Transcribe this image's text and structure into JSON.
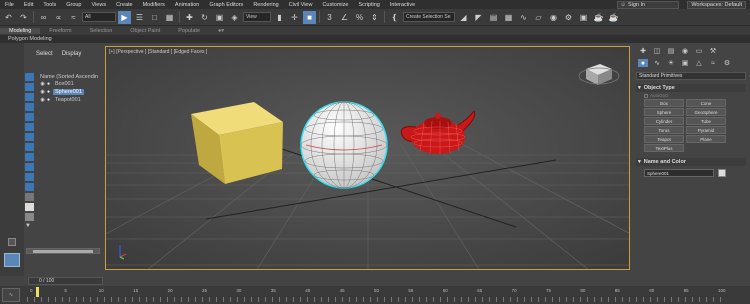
{
  "menu": [
    "File",
    "Edit",
    "Tools",
    "Group",
    "Views",
    "Create",
    "Modifiers",
    "Animation",
    "Graph Editors",
    "Rendering",
    "Civil View",
    "Customize",
    "Scripting",
    "Interactive"
  ],
  "signin": {
    "label": "Sign In"
  },
  "workspace": {
    "label": "Workspaces: Default"
  },
  "toolbar": {
    "filter_value": "All",
    "view_value": "View",
    "snap_3": "3",
    "percent": "%",
    "selection_set_placeholder": "Create Selection Se"
  },
  "ribbon": {
    "tabs": [
      "Modeling",
      "Freeform",
      "Selection",
      "Object Paint",
      "Populate"
    ],
    "active": "Modeling",
    "sub": "Polygon Modeling"
  },
  "scene_explorer": {
    "tabs": [
      "Select",
      "Display"
    ],
    "header": "Name (Sorted Ascendin",
    "items": [
      {
        "name": "Box001",
        "selected": false
      },
      {
        "name": "Sphere001",
        "selected": true
      },
      {
        "name": "Teapot001",
        "selected": false
      }
    ]
  },
  "viewport": {
    "label": "[+] [Perspective ] [Standard ] [Edged Faces ]",
    "border_color": "#c8a040",
    "box_color": "#d8c251",
    "teapot_color": "#c81818",
    "sphere_color": "#f4f4f4",
    "selection_color": "#30e0f0"
  },
  "command_panel": {
    "dropdown": "Standard Primitives",
    "object_type_title": "Object Type",
    "autogrid": "AutoGrid",
    "buttons": [
      "Box",
      "Cone",
      "Sphere",
      "GeoSphere",
      "Cylinder",
      "Tube",
      "Torus",
      "Pyramid",
      "Teapot",
      "Plane",
      "TextPlus"
    ],
    "name_color_title": "Name and Color",
    "object_name": "Sphere001"
  },
  "timeslider": {
    "value": "0 / 100"
  },
  "trackbar": {
    "labels": [
      "0",
      "5",
      "10",
      "15",
      "20",
      "25",
      "30",
      "35",
      "40",
      "45",
      "50",
      "55",
      "60",
      "65",
      "70",
      "75",
      "80",
      "85",
      "90",
      "95",
      "100"
    ]
  },
  "icons": [
    "undo-icon",
    "redo-icon",
    "link-icon",
    "unlink-icon",
    "bind-icon",
    "select-icon",
    "select-by-name-icon",
    "rect-region-icon",
    "window-crossing-icon",
    "move-icon",
    "rotate-icon",
    "scale-icon",
    "select-manipulate-icon",
    "pivot-icon",
    "snap-icon",
    "angle-snap-icon",
    "percent-snap-icon",
    "spinner-snap-icon",
    "edit-named-selection-icon",
    "mirror-icon",
    "align-icon",
    "layer-icon",
    "render-setup-icon",
    "render-icon"
  ]
}
